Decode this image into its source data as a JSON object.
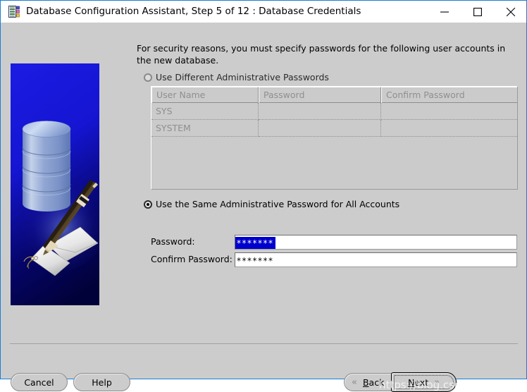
{
  "window": {
    "title": "Database Configuration Assistant, Step 5 of 12 : Database Credentials",
    "icon": "database-assistant-icon",
    "controls": {
      "minimize": "minimize-icon",
      "maximize": "maximize-icon",
      "close": "close-icon"
    },
    "border_color": "#1a7fd4",
    "titlebar_bg": "#ffffff",
    "client_bg": "#cccccc"
  },
  "banner": {
    "name": "database-credentials-illustration",
    "bg_top": "#1313cf",
    "bg_bottom": "#00004f"
  },
  "main": {
    "intro": "For security reasons, you must specify passwords for the following user accounts in the new database.",
    "options": {
      "different": {
        "label": "Use Different Administrative Passwords",
        "selected": false,
        "enabled": true
      },
      "same": {
        "label": "Use the Same Administrative Password for All Accounts",
        "selected": true,
        "enabled": true
      }
    },
    "table": {
      "enabled": false,
      "columns": [
        "User Name",
        "Password",
        "Confirm Password"
      ],
      "rows": [
        [
          "SYS",
          "",
          ""
        ],
        [
          "SYSTEM",
          "",
          ""
        ]
      ]
    },
    "fields": {
      "password": {
        "label": "Password:",
        "value": "*******",
        "selected": true,
        "placeholder": ""
      },
      "confirm": {
        "label": "Confirm Password:",
        "value": "*******",
        "selected": false,
        "placeholder": ""
      }
    }
  },
  "footer": {
    "cancel": "Cancel",
    "help": "Help",
    "back": "Back",
    "next": "Next",
    "back_chevron": "chevron-left-double-icon",
    "next_chevron": "chevron-right-double-icon"
  },
  "watermark": "https://blog.csdn.net/tyhawk"
}
